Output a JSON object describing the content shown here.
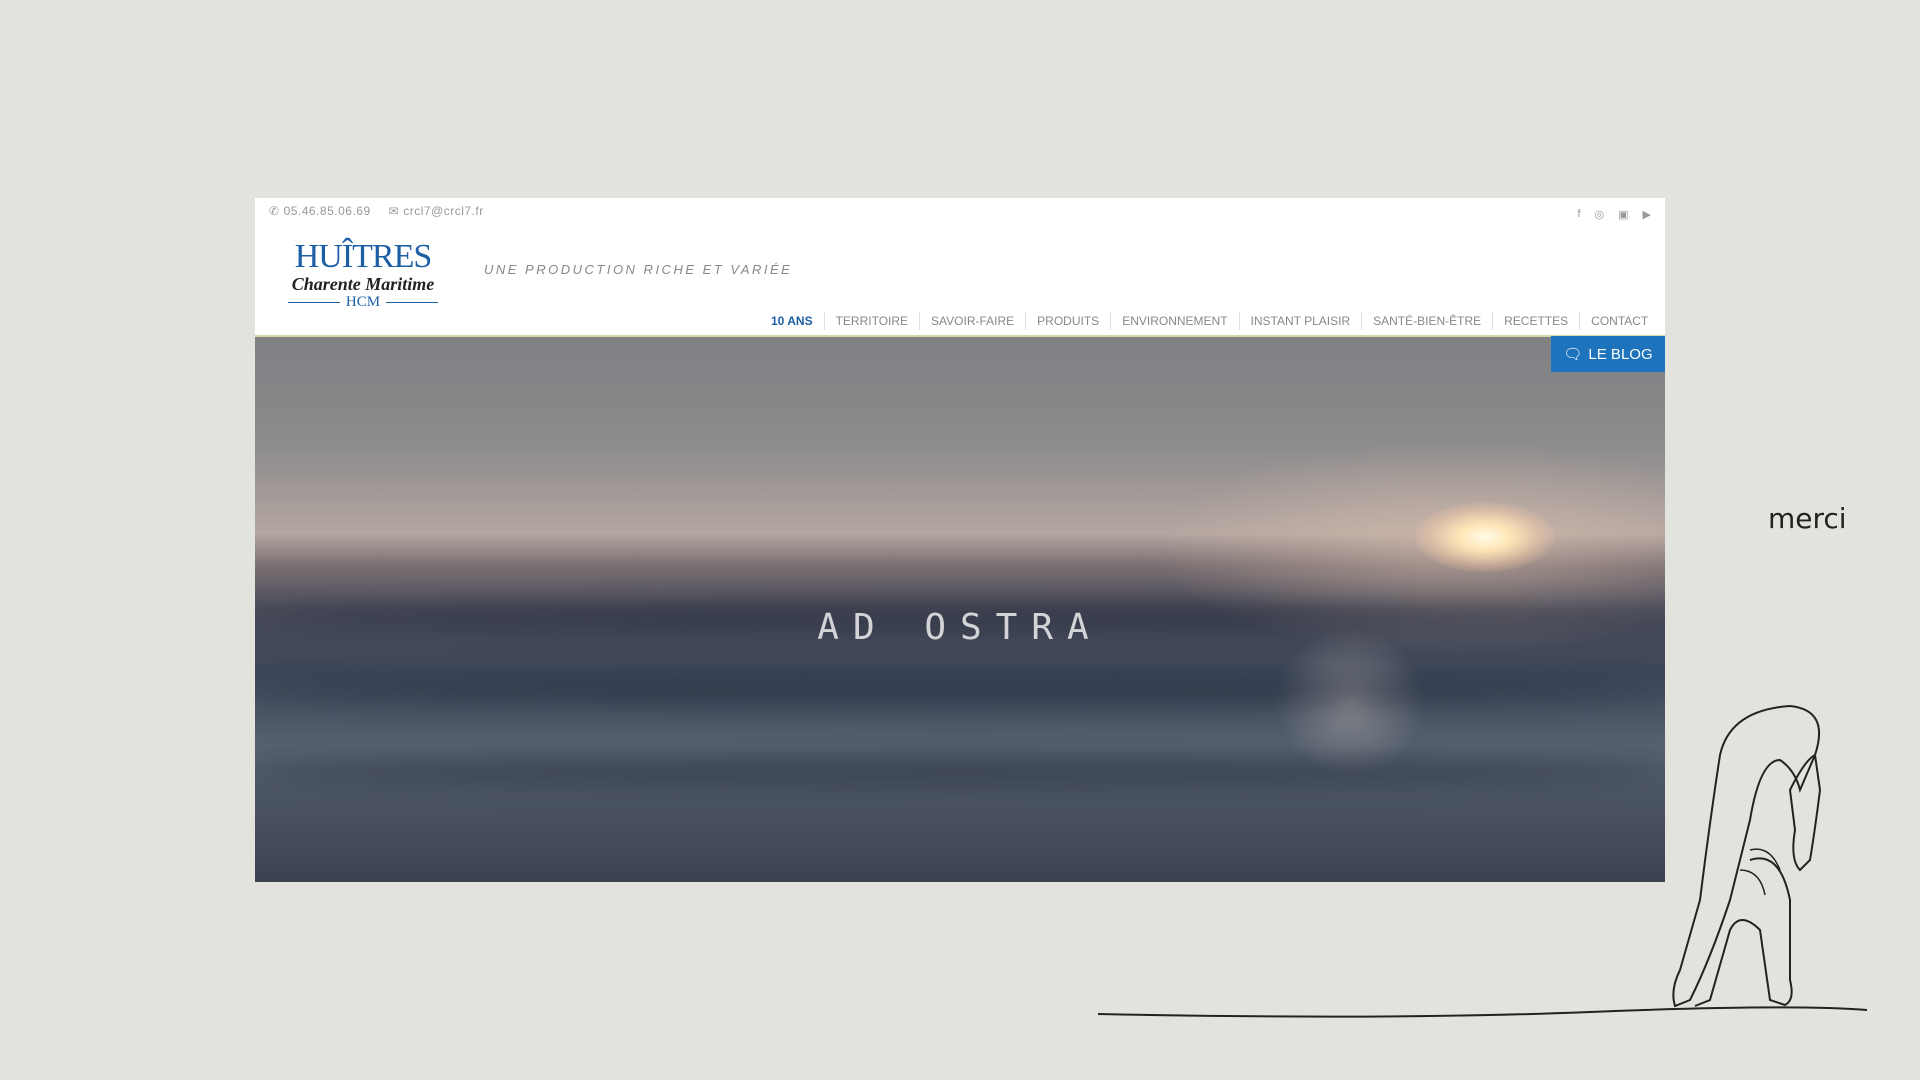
{
  "contact": {
    "phone": "05.46.85.06.69",
    "email": "crcl7@crcl7.fr",
    "phone_icon": "phone-icon",
    "email_icon": "envelope-icon"
  },
  "social": [
    "facebook-icon",
    "tripadvisor-icon",
    "instagram-icon",
    "youtube-icon"
  ],
  "logo": {
    "line1": "HUÎTRES",
    "line2": "Charente Maritime",
    "line3": "HCM"
  },
  "tagline": "UNE PRODUCTION RICHE ET VARIÉE",
  "nav": [
    "10 ANS",
    "TERRITOIRE",
    "SAVOIR-FAIRE",
    "PRODUITS",
    "ENVIRONNEMENT",
    "INSTANT PLAISIR",
    "SANTÉ-BIEN-ÊTRE",
    "RECETTES",
    "CONTACT"
  ],
  "blog_label": "LE BLOG",
  "hero_title": "AD OSTRA",
  "merci": "merci",
  "colors": {
    "brand": "#1d5fa5",
    "blog": "#1d74bd",
    "background": "#e3e3de"
  }
}
